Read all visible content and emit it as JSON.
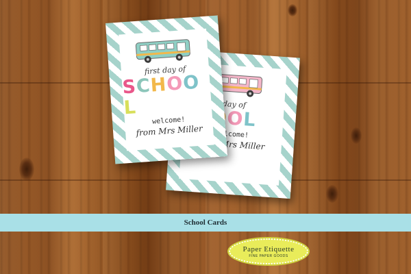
{
  "cards": [
    {
      "id": "front",
      "line1": "first day of",
      "school_letters": [
        {
          "char": "S",
          "color": "#e9578a"
        },
        {
          "char": "C",
          "color": "#8cc6ba"
        },
        {
          "char": "H",
          "color": "#f2b84b"
        },
        {
          "char": "O",
          "color": "#f49ab8"
        },
        {
          "char": "O",
          "color": "#7fc3c9"
        },
        {
          "char": "L",
          "color": "#d8df5a"
        }
      ],
      "line2": "welcome!",
      "line3": "from Mrs Miller",
      "bus_color": "#8fcfc4"
    },
    {
      "id": "back",
      "line1": "day of",
      "school_letters": [
        {
          "char": "O",
          "color": "#f2b84b"
        },
        {
          "char": "O",
          "color": "#f49ab8"
        },
        {
          "char": "L",
          "color": "#7fc3c9"
        }
      ],
      "line2": "welcome!",
      "line3": "from Mrs Miller",
      "bus_color": "#f4b6c9"
    }
  ],
  "banner": {
    "title": "School Cards"
  },
  "logo": {
    "main": "Paper Etiquette",
    "sub": "FINE PAPER GOODS"
  },
  "colors": {
    "stripe": "#a6d3cb",
    "banner": "#a9e0e7",
    "logo": "#e9ec5a",
    "wood": "#9c5c2a"
  }
}
